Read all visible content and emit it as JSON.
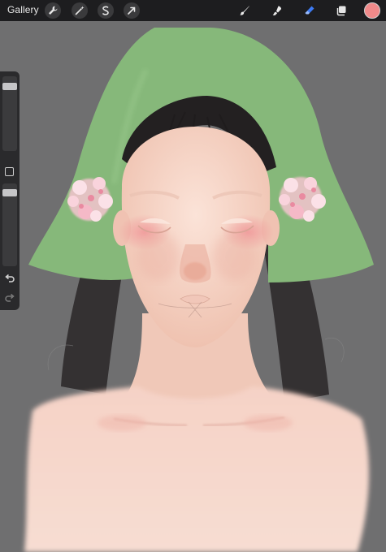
{
  "toolbar": {
    "gallery_label": "Gallery",
    "left_tools": [
      {
        "name": "actions-wrench-icon"
      },
      {
        "name": "adjustments-wand-icon"
      },
      {
        "name": "selection-icon"
      },
      {
        "name": "transform-arrow-icon"
      }
    ],
    "right_tools": [
      {
        "name": "brush-icon"
      },
      {
        "name": "smudge-icon"
      },
      {
        "name": "eraser-icon",
        "active": true
      },
      {
        "name": "layers-icon"
      }
    ],
    "current_color": "#f08a8a"
  },
  "sidebar": {
    "brush_size_slider": "brush-size",
    "opacity_slider": "brush-opacity",
    "modify_button": "modify-square-icon",
    "undo": "undo-icon",
    "redo": "redo-icon"
  },
  "colors": {
    "accent_eraser": "#3d7bf5",
    "hat_green": "#86b87a",
    "background_gray": "#6f6f70",
    "skin": "#f4d8cc",
    "flower_pink": "#f1b6c2"
  }
}
